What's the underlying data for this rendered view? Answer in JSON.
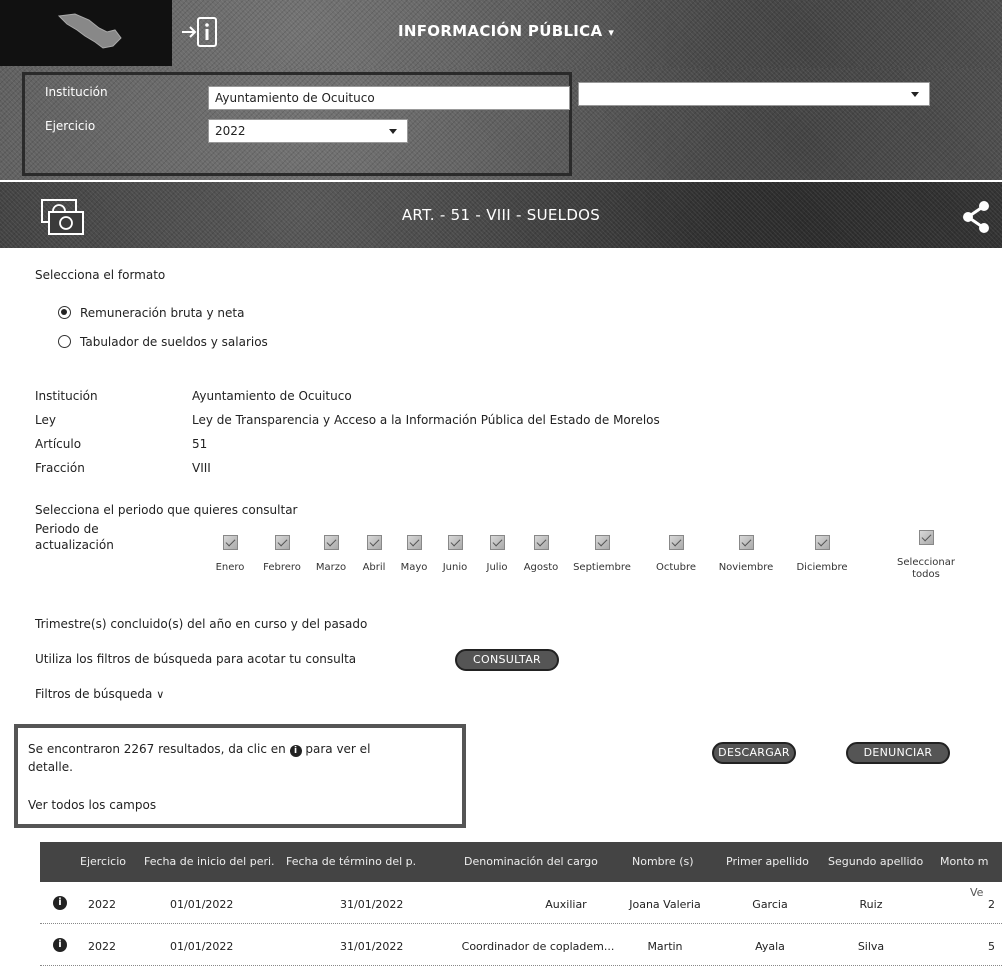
{
  "header": {
    "title": "INFORMACIÓN PÚBLICA",
    "info_icon": "info-door-icon"
  },
  "filters": {
    "institucion_label": "Institución",
    "institucion_value": "Ayuntamiento de Ocuituco",
    "ejercicio_label": "Ejercicio",
    "ejercicio_value": "2022",
    "second_select_value": ""
  },
  "section": {
    "title": "ART. - 51 - VIII - SUELDOS"
  },
  "formato": {
    "heading": "Selecciona el formato",
    "options": [
      {
        "label": "Remuneración bruta y neta",
        "selected": true
      },
      {
        "label": "Tabulador de sueldos y salarios",
        "selected": false
      }
    ]
  },
  "details": [
    {
      "label": "Institución",
      "value": "Ayuntamiento de Ocuituco"
    },
    {
      "label": "Ley",
      "value": "Ley de Transparencia y Acceso a la Información Pública del Estado de Morelos"
    },
    {
      "label": "Artículo",
      "value": "51"
    },
    {
      "label": "Fracción",
      "value": "VIII"
    }
  ],
  "periodo": {
    "heading": "Selecciona el periodo que quieres consultar",
    "label_line1": "Periodo de",
    "label_line2": "actualización",
    "months": [
      "Enero",
      "Febrero",
      "Marzo",
      "Abril",
      "Mayo",
      "Junio",
      "Julio",
      "Agosto",
      "Septiembre",
      "Octubre",
      "Noviembre",
      "Diciembre"
    ],
    "select_all_line1": "Seleccionar",
    "select_all_line2": "todos"
  },
  "trimestre_text": "Trimestre(s) concluido(s) del año en curso y del pasado",
  "filtros_text": "Utiliza los filtros de búsqueda para acotar tu consulta",
  "consultar_label": "CONSULTAR",
  "filtros_busqueda": "Filtros de búsqueda",
  "results": {
    "line1": "Se encontraron 2267 resultados, da clic en",
    "line1_after": "para ver el",
    "line2": "detalle.",
    "ver_todos": "Ver todos los campos"
  },
  "descargar_label": "DESCARGAR",
  "denunciar_label": "DENUNCIAR",
  "table": {
    "headers": [
      "Ejercicio",
      "Fecha de inicio del peri...",
      "Fecha de término del p...",
      "Denominación del cargo",
      "Nombre (s)",
      "Primer apellido",
      "Segundo apellido",
      "Monto m"
    ],
    "rows": [
      [
        "2022",
        "01/01/2022",
        "31/01/2022",
        "Auxiliar",
        "Joana Valeria",
        "Garcia",
        "Ruiz",
        "2"
      ],
      [
        "2022",
        "01/01/2022",
        "31/01/2022",
        "Coordinador de copladem...",
        "Martin",
        "Ayala",
        "Silva",
        "5"
      ]
    ],
    "overlay_text": "Ve"
  }
}
